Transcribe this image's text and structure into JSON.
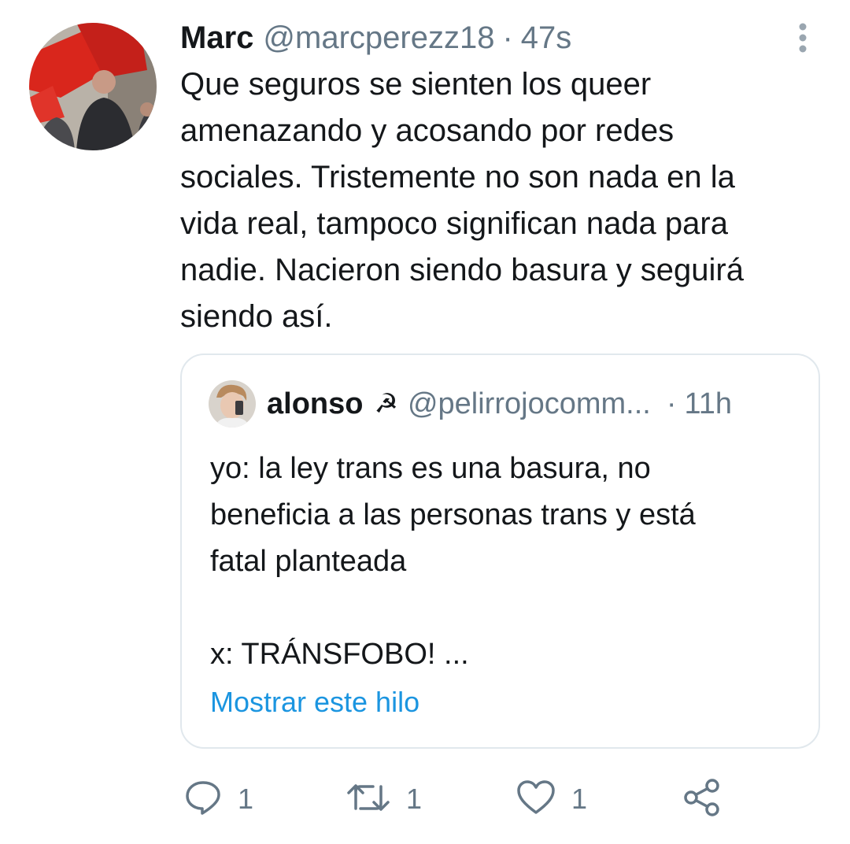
{
  "tweet": {
    "author": {
      "name": "Marc",
      "handle": "@marcperezz18",
      "separator": "·",
      "time": "47s"
    },
    "text": "Que seguros se sienten los queer\namenazando y acosando por redes\nsociales. Tristemente no son nada en la\nvida real, tampoco significan nada para\nnadie. Nacieron siendo basura y seguirá\nsiendo así.",
    "menu_icon": "more-vertical-icon",
    "quote": {
      "author": {
        "name": "alonso",
        "emoji": "☭",
        "handle": "@pelirrojocomm...",
        "separator": "·",
        "time": "11h"
      },
      "text": "yo: la ley trans es una basura, no\nbeneficia a las personas trans y está\nfatal planteada\n\nx: TRÁNSFOBO! ...",
      "show_thread": "Mostrar este hilo"
    },
    "actions": {
      "reply": {
        "icon": "reply-icon",
        "count": "1"
      },
      "retweet": {
        "icon": "retweet-icon",
        "count": "1"
      },
      "like": {
        "icon": "heart-icon",
        "count": "1"
      },
      "share": {
        "icon": "share-icon"
      }
    }
  },
  "colors": {
    "text": "#14171a",
    "secondary": "#657786",
    "link": "#1b95e0",
    "border": "#e1e8ed"
  }
}
